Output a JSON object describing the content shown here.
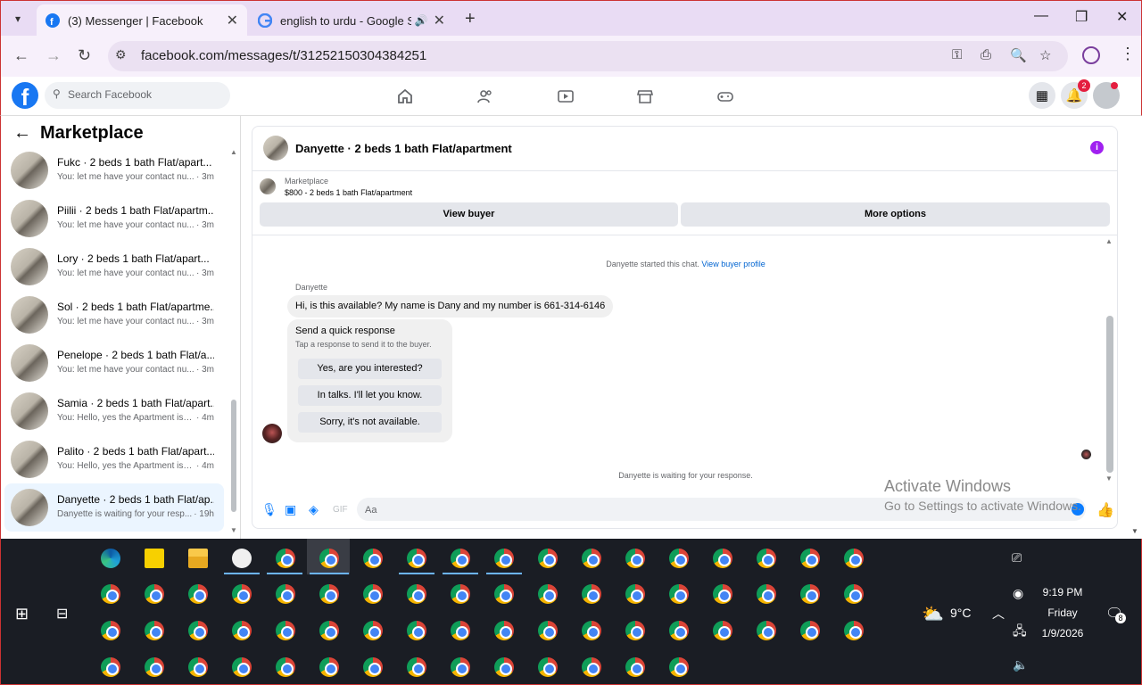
{
  "browser": {
    "tabs": [
      {
        "title": "(3) Messenger | Facebook",
        "active": true
      },
      {
        "title": "english to urdu - Google Se",
        "active": false
      }
    ],
    "url": "facebook.com/messages/t/31252150304384251"
  },
  "fb": {
    "search_placeholder": "Search Facebook",
    "notification_count": "2"
  },
  "marketplace": {
    "title": "Marketplace",
    "conversations": [
      {
        "name": "Fukc · 2 beds 1 bath Flat/apart...",
        "preview": "You: let me have your contact nu...",
        "time": "· 3m"
      },
      {
        "name": "Piilii · 2 beds 1 bath Flat/apartm...",
        "preview": "You: let me have your contact nu...",
        "time": "· 3m"
      },
      {
        "name": "Lory · 2 beds 1 bath Flat/apart...",
        "preview": "You: let me have your contact nu...",
        "time": "· 3m"
      },
      {
        "name": "Sol · 2 beds 1 bath Flat/apartme...",
        "preview": "You: let me have your contact nu...",
        "time": "· 3m"
      },
      {
        "name": "Penelope · 2 beds 1 bath Flat/a...",
        "preview": "You: let me have your contact nu...",
        "time": "· 3m"
      },
      {
        "name": "Samia · 2 beds 1 bath Flat/apart...",
        "preview": "You: Hello, yes the Apartment is st...",
        "time": "· 4m"
      },
      {
        "name": "Palito · 2 beds 1 bath Flat/apart...",
        "preview": "You: Hello, yes the Apartment is st...",
        "time": "· 4m"
      },
      {
        "name": "Danyette · 2 beds 1 bath Flat/ap...",
        "preview": "Danyette is waiting for your resp...",
        "time": "· 19h"
      }
    ]
  },
  "chat": {
    "title": "Danyette · 2 beds 1 bath Flat/apartment",
    "marketplace_label": "Marketplace",
    "listing": "$800 - 2 beds 1 bath Flat/apartment",
    "view_buyer": "View buyer",
    "more_options": "More options",
    "started_text": "Danyette started this chat.",
    "view_buyer_profile": "View buyer profile",
    "sender": "Danyette",
    "message": "Hi, is this available? My name is Dany and my number is 661-314-6146",
    "quick_title": "Send a quick response",
    "quick_sub": "Tap a response to send it to the buyer.",
    "quick_responses": [
      "Yes, are you interested?",
      "In talks. I'll let you know.",
      "Sorry, it's not available."
    ],
    "waiting": "Danyette is waiting for your response.",
    "input_placeholder": "Aa"
  },
  "watermark": {
    "line1": "Activate Windows",
    "line2": "Go to Settings to activate Windows."
  },
  "taskbar": {
    "temperature": "9°C",
    "time": "9:19 PM",
    "day": "Friday",
    "date": "1/9/2026",
    "notifications": "8"
  }
}
